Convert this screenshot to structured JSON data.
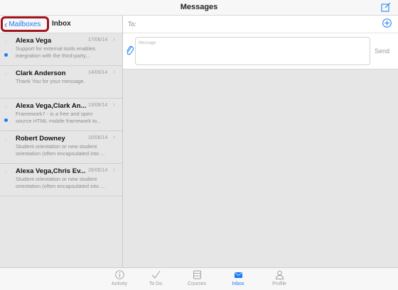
{
  "header": {
    "title": "Messages",
    "compose_icon": "compose-icon"
  },
  "left_header": {
    "back_label": "Mailboxes",
    "title": "Inbox"
  },
  "messages": [
    {
      "name": "Alexa Vega",
      "date": "17/06/14",
      "preview_line1": "Support for external tools enables",
      "preview_line2": "integration with the third-party...",
      "unread": true
    },
    {
      "name": "Clark Anderson",
      "date": "14/06/14",
      "preview_line1": "Thank You for your message.",
      "preview_line2": "",
      "unread": false
    },
    {
      "name": "Alexa Vega,Clark An...",
      "date": "13/06/14",
      "preview_line1": "Framework7 - is a free and open",
      "preview_line2": "source HTML mobile framework to...",
      "unread": true
    },
    {
      "name": "Robert Downey",
      "date": "10/06/14",
      "preview_line1": "Student orientation or new student",
      "preview_line2": "orientation (often encapsulated into ...",
      "unread": false
    },
    {
      "name": "Alexa Vega,Chris Ev...",
      "date": "28/05/14",
      "preview_line1": "Student orientation or new student",
      "preview_line2": "orientation (often encapsulated into ...",
      "unread": false
    }
  ],
  "compose": {
    "to_label": "To:",
    "message_placeholder": "Message",
    "send_label": "Send"
  },
  "tabs": [
    {
      "label": "Activity",
      "icon": "info-icon",
      "active": false
    },
    {
      "label": "To Do",
      "icon": "checkmark-icon",
      "active": false
    },
    {
      "label": "Courses",
      "icon": "courses-icon",
      "active": false
    },
    {
      "label": "Inbox",
      "icon": "inbox-icon",
      "active": true
    },
    {
      "label": "Profile",
      "icon": "profile-icon",
      "active": false
    }
  ],
  "colors": {
    "accent": "#1a7cf5",
    "highlight_border": "#a1141e"
  }
}
